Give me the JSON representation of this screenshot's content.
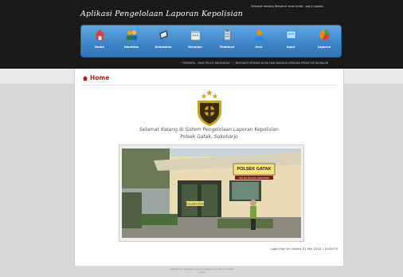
{
  "header": {
    "app_title": "Aplikasi Pengelolaan Laporan Kepolisian",
    "user_bar": "Selamat datang Ifentaru! level anda : spk | Logout"
  },
  "nav": {
    "items": [
      {
        "label": "Home",
        "icon": "home-icon",
        "color": "#e53935"
      },
      {
        "label": "Identitas",
        "icon": "users-icon",
        "color": "#f39c12"
      },
      {
        "label": "Kelurahan",
        "icon": "book-icon",
        "color": "#455a64"
      },
      {
        "label": "Kejadian",
        "icon": "calendar-icon",
        "color": "#cfd8dc"
      },
      {
        "label": "Tindakan",
        "icon": "clipboard-icon",
        "color": "#90a4ae"
      },
      {
        "label": "User",
        "icon": "person-icon",
        "color": "#fb8c00"
      },
      {
        "label": "Input",
        "icon": "form-icon",
        "color": "#4a90d9"
      },
      {
        "label": "Laporan",
        "icon": "piechart-icon",
        "color": "#e53935"
      }
    ]
  },
  "marquee": {
    "text": "~ TRIBRATA - RAHI POLISI INDONESIA ~ | BERSAKTI KEPADA NUSA DAN BANGSA DENGAN PENUH KETAQWAAN"
  },
  "main": {
    "title": "Home",
    "welcome_line1": "Selamat datang di Sistem Pengelolaan Laporan Kepolisian",
    "welcome_line2": "Polsek Gatak, Sukoharjo",
    "sign_main": "POLSEK GATAK",
    "sign_sub": "SATUAN WILAYAH KABUPATEN",
    "sign_window": "POLSEK GATAK",
    "login_time": "Login Hari ini: Kamis 31 Mei 2018 | 10:49:33"
  },
  "footer": {
    "line1": "Aplikasi Pengelolaan Laporan Kepolisian Polsek Gatak",
    "line2": "2018"
  },
  "colors": {
    "nav_bar": "#3f87c9",
    "header_bg": "#1a1a1a",
    "title_red": "#b01c1c"
  }
}
